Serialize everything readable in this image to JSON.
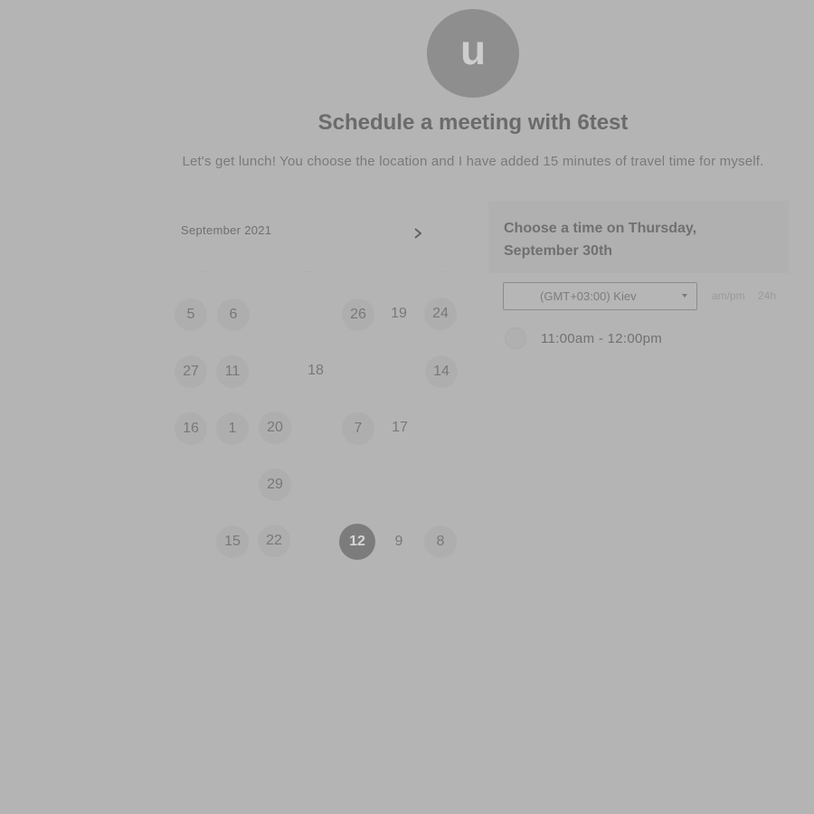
{
  "host": {
    "avatar_letter": "u",
    "title": "Schedule a meeting with 6test",
    "description": "Let's get lunch! You choose the location and I have added 15 minutes of travel time for myself."
  },
  "calendar": {
    "month_label": "September 2021",
    "next_icon": "chevron-right-icon",
    "selected_day": "12",
    "days": {
      "d5": "5",
      "d6": "6",
      "d26": "26",
      "d19": "19",
      "d24": "24",
      "d27": "27",
      "d11": "11",
      "d18": "18",
      "d14": "14",
      "d16": "16",
      "d1": "1",
      "d20": "20",
      "d7": "7",
      "d17": "17",
      "d29": "29",
      "d15": "15",
      "d22": "22",
      "d12": "12",
      "d9": "9",
      "d8": "8"
    }
  },
  "times": {
    "heading": "Choose a time on Thursday, September 30th",
    "timezone": "(GMT+03:00) Kiev",
    "format_ampm": "am/pm",
    "format_24h": "24h",
    "slots": [
      {
        "label": "11:00am - 12:00pm"
      }
    ]
  }
}
